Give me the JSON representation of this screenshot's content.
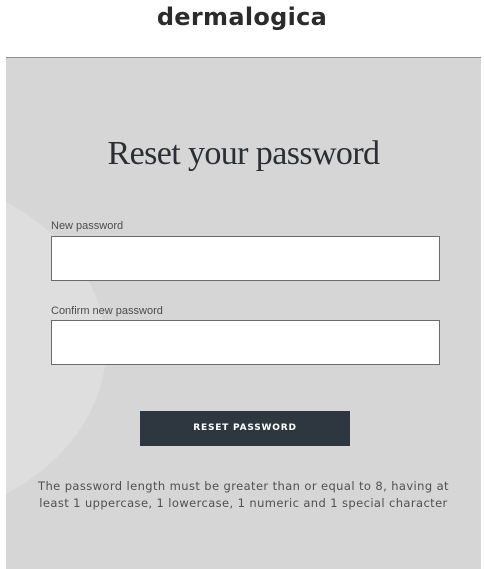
{
  "header": {
    "logo_text": "dermalogica"
  },
  "form": {
    "title": "Reset your password",
    "new_password": {
      "label": "New password",
      "value": "",
      "placeholder": ""
    },
    "confirm_password": {
      "label": "Confirm new password",
      "value": "",
      "placeholder": ""
    },
    "submit_label": "RESET PASSWORD",
    "hint": "The password length must be greater than or equal to 8, having at least 1 uppercase, 1 lowercase, 1 numeric and 1 special character"
  },
  "colors": {
    "panel_background": "#d6d6d6",
    "button_background": "#2e3740",
    "button_text": "#ffffff",
    "title_text": "#2b2e33"
  }
}
